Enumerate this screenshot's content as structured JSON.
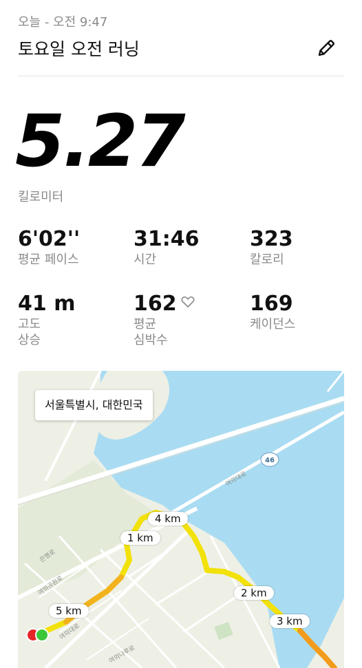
{
  "header": {
    "date": "오늘 - 오전 9:47",
    "title": "토요일 오전 러닝",
    "edit_icon": "pencil-icon"
  },
  "distance": {
    "value": "5.27",
    "unit": "킬로미터"
  },
  "stats": [
    {
      "value": "6'02''",
      "label": "평균 페이스"
    },
    {
      "value": "31:46",
      "label": "시간"
    },
    {
      "value": "323",
      "label": "칼로리"
    },
    {
      "value": "41 m",
      "label_line1": "고도",
      "label_line2": "상승"
    },
    {
      "value": "162",
      "label_line1": "평균",
      "label_line2": "심박수",
      "icon": "heart-icon"
    },
    {
      "value": "169",
      "label": "케이던스"
    }
  ],
  "map": {
    "location": "서울특별시, 대한민국",
    "route_highway_badge": "46",
    "km_markers": [
      "1 km",
      "2 km",
      "3 km",
      "4 km",
      "5 km"
    ],
    "road_labels": [
      "여의대로",
      "은행로",
      "여의공원로",
      "여의대로",
      "여의나루로"
    ],
    "colors": {
      "water": "#a9dcf2",
      "land": "#eef0e6",
      "route_yellow": "#f2e10a",
      "route_orange": "#f29b1d",
      "start_dot": "#e6262a",
      "end_dot": "#3cc63a"
    }
  }
}
